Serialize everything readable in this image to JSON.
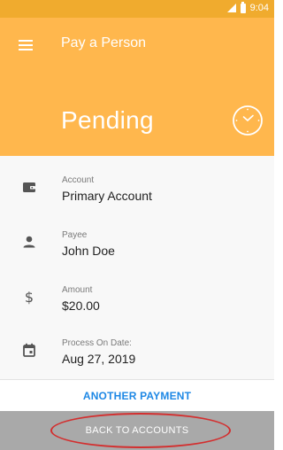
{
  "status_bar": {
    "time": "9:04"
  },
  "header": {
    "title": "Pay a Person",
    "status": "Pending",
    "menu_icon": "hamburger-menu-icon",
    "status_icon": "clock-icon",
    "background_color": "#ffb74d"
  },
  "details": [
    {
      "icon": "wallet-icon",
      "label": "Account",
      "value": "Primary Account"
    },
    {
      "icon": "person-icon",
      "label": "Payee",
      "value": "John Doe"
    },
    {
      "icon": "dollar-icon",
      "label": "Amount",
      "value": "$20.00"
    },
    {
      "icon": "calendar-icon",
      "label": "Process On Date:",
      "value": "Aug 27, 2019"
    }
  ],
  "actions": {
    "another_payment": "ANOTHER PAYMENT",
    "back_to_accounts": "BACK TO ACCOUNTS"
  },
  "colors": {
    "accent": "#ffb74d",
    "link": "#1e88e5",
    "secondary_button": "#a9a9a9",
    "annotation": "#d32f2f"
  }
}
